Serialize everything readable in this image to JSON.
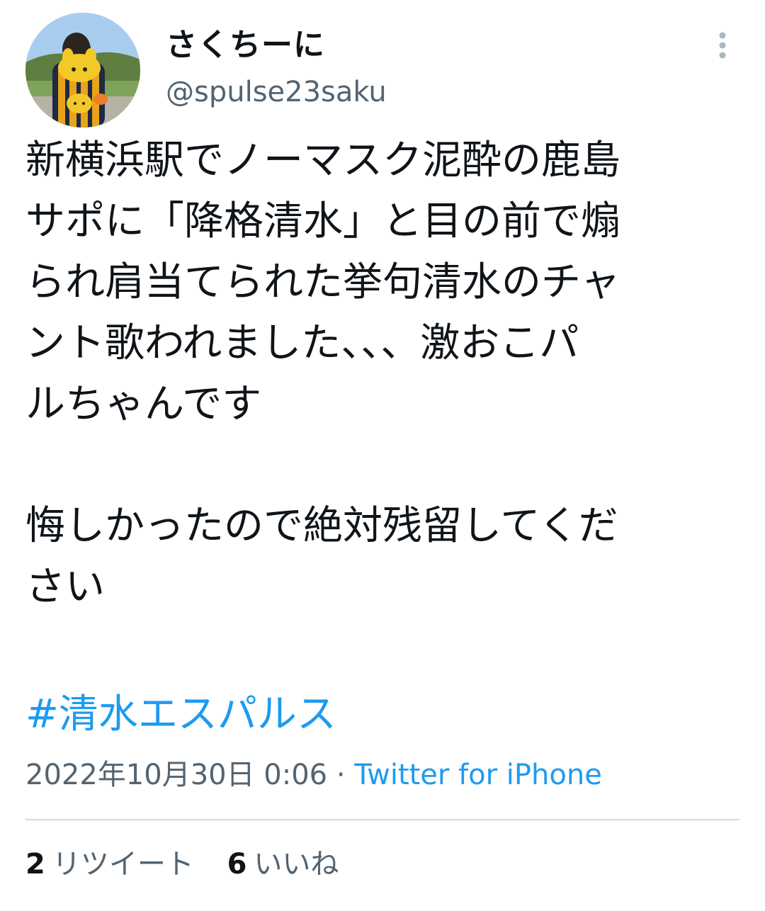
{
  "author": {
    "display_name": "さくちーに",
    "handle": "@spulse23saku",
    "avatar_icon": "profile-photo"
  },
  "more_icon": "more-vertical-icon",
  "tweet": {
    "lines": [
      "新横浜駅でノーマスク泥酔の鹿島",
      "サポに「降格清水」と目の前で煽",
      "られ肩当てられた挙句清水のチャ",
      "ント歌われました、、、激おこパ",
      "ルちゃんです",
      "",
      "悔しかったので絶対残留してくだ",
      "さい"
    ],
    "hashtag": "#清水エスパルス"
  },
  "meta": {
    "timestamp": "2022年10月30日 0:06",
    "separator": "·",
    "source": "Twitter for iPhone"
  },
  "stats": {
    "retweets_count": "2",
    "retweets_label": "リツイート",
    "likes_count": "6",
    "likes_label": "いいね"
  },
  "colors": {
    "text": "#0f1419",
    "secondary": "#536471",
    "accent": "#1d9bf0",
    "divider": "#cfd9de"
  }
}
